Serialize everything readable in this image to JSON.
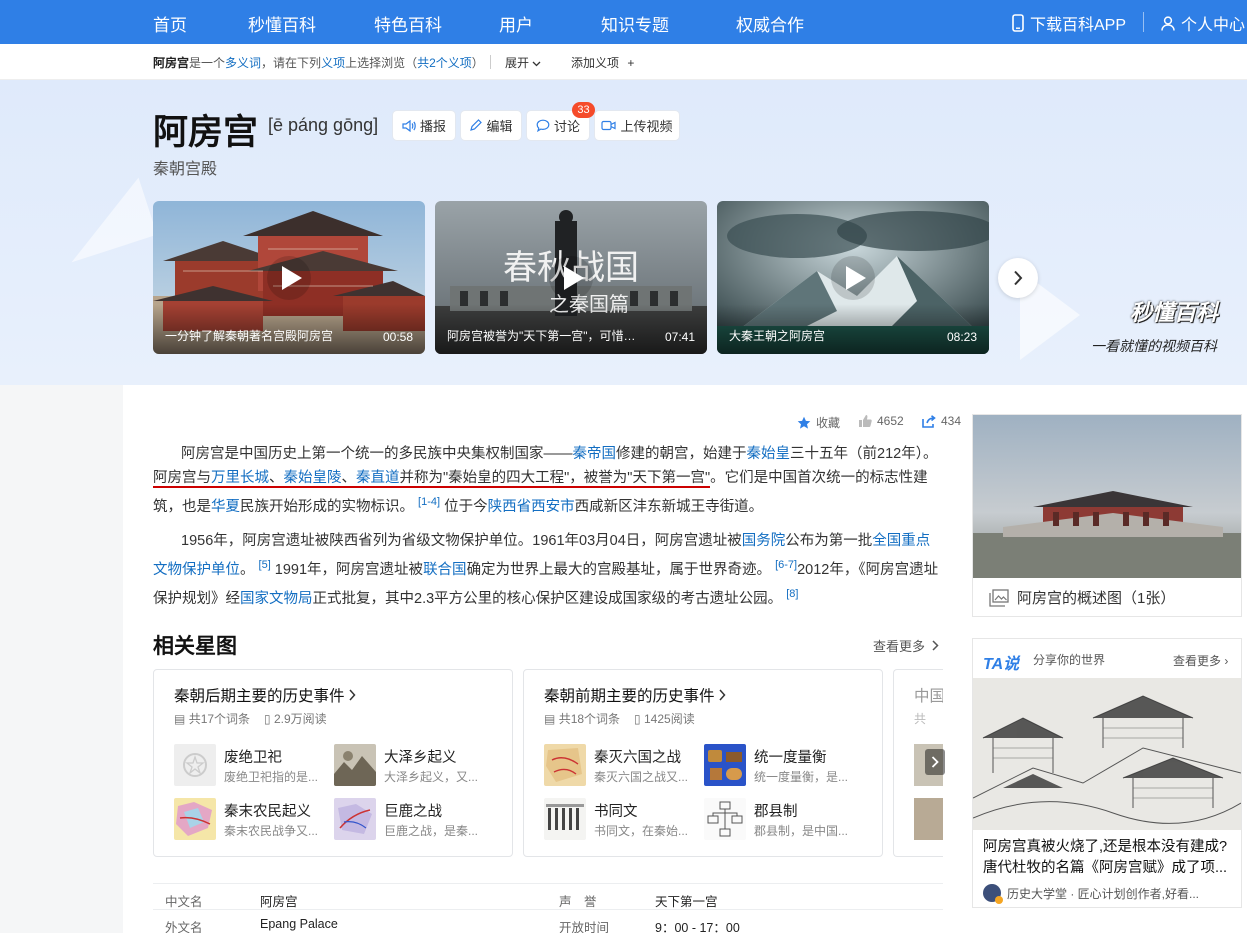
{
  "nav": {
    "items": [
      "首页",
      "秒懂百科",
      "特色百科",
      "用户",
      "知识专题",
      "权威合作"
    ],
    "download_app": "下载百科APP",
    "user_center": "个人中心"
  },
  "disambig": {
    "term": "阿房宫",
    "text1": "是一个",
    "polysemy": "多义词",
    "text2": "，请在下列",
    "sense": "义项",
    "text3": "上选择浏览（",
    "count": "共2个义项",
    "text4": "）",
    "expand": "展开",
    "add_term": "添加义项"
  },
  "header": {
    "title": "阿房宫",
    "pinyin": "[ē páng gōng]",
    "subtitle": "秦朝宫殿",
    "buttons": {
      "broadcast": "播报",
      "edit": "编辑",
      "discuss": "讨论",
      "upload": "上传视频"
    },
    "discuss_badge": "33"
  },
  "videos": [
    {
      "caption": "一分钟了解秦朝著名宫殿阿房宫",
      "duration": "00:58"
    },
    {
      "caption": "阿房宫被誉为\"天下第一宫\"，可惜最...",
      "duration": "07:41",
      "overlay_title": "春秋战国",
      "overlay_sub": "之秦国篇"
    },
    {
      "caption": "大秦王朝之阿房宫",
      "duration": "08:23"
    }
  ],
  "brand": {
    "name": "秒懂百科",
    "slogan": "一看就懂的视频百科"
  },
  "stats": {
    "favorite": "收藏",
    "likes": "4652",
    "shares": "434"
  },
  "intro": {
    "p1": {
      "a": "阿房宫是中国历史上第一个统一的多民族中央集权制国家——",
      "l1": "秦帝国",
      "b": "修建的朝宫，始建于",
      "l2": "秦始皇",
      "c": "三十五年（前212年）。",
      "u1": "阿房宫与",
      "l3": "万里长城",
      "s1": "、",
      "l4": "秦始皇陵",
      "s2": "、",
      "l5": "秦直道",
      "u2": "并称为\"秦始皇的四大工程\"，被誉为\"天下第一宫\"",
      "u3": "。",
      "d": "它们是中国首次统一的标志性建筑，也是",
      "l6": "华夏",
      "e": "民族开始形成的实物标识。",
      "ref1": "[1-4]",
      "f": "位于今",
      "l7": "陕西省西安市",
      "g": "西咸新区沣东新城王寺街道。"
    },
    "p2": {
      "a": "1956年，阿房宫遗址被陕西省列为省级文物保护单位。1961年03月04日，阿房宫遗址被",
      "l1": "国务院",
      "b": "公布为第一批",
      "l2": "全国重点文物保护单位",
      "c": "。",
      "ref1": "[5]",
      "d": "1991年，阿房宫遗址被",
      "l3": "联合国",
      "e": "确定为世界上最大的宫殿基址，属于世界奇迹。",
      "ref2": "[6-7]",
      "f": "2012年，《阿房宫遗址保护规划》经",
      "l4": "国家文物局",
      "g": "正式批复，其中2.3平方公里的核心保护区建设成国家级的考古遗址公园。",
      "ref3": "[8]"
    }
  },
  "related": {
    "title": "相关星图",
    "more": "查看更多",
    "cards": [
      {
        "title": "秦朝后期主要的历史事件",
        "terms": "共17个词条",
        "reads": "2.9万阅读",
        "items": [
          {
            "name": "废绝卫祀",
            "desc": "废绝卫祀指的是..."
          },
          {
            "name": "大泽乡起义",
            "desc": "大泽乡起义，又..."
          },
          {
            "name": "秦末农民起义",
            "desc": "秦末农民战争又..."
          },
          {
            "name": "巨鹿之战",
            "desc": "巨鹿之战，是秦..."
          }
        ]
      },
      {
        "title": "秦朝前期主要的历史事件",
        "terms": "共18个词条",
        "reads": "1425阅读",
        "items": [
          {
            "name": "秦灭六国之战",
            "desc": "秦灭六国之战又..."
          },
          {
            "name": "统一度量衡",
            "desc": "统一度量衡，是..."
          },
          {
            "name": "书同文",
            "desc": "书同文，在秦始..."
          },
          {
            "name": "郡县制",
            "desc": "郡县制，是中国..."
          }
        ]
      }
    ],
    "peek_title": "中国",
    "peek_meta": "共"
  },
  "infobox": [
    {
      "k1": "中文名",
      "v1": "阿房宫",
      "k2": "声　誉",
      "v2": "天下第一宫"
    },
    {
      "k1": "外文名",
      "v1": "Epang Palace",
      "k2": "开放时间",
      "v2": "9：00 - 17：00"
    }
  ],
  "summary": {
    "caption": "阿房宫的概述图（1张）"
  },
  "ta": {
    "logo": "TA说",
    "slogan": "分享你的世界",
    "more": "查看更多",
    "headline": "阿房宫真被火烧了,还是根本没有建成?唐代杜牧的名篇《阿房宫赋》成了项...",
    "author": "历史大学堂 · 匠心计划创作者,好看..."
  },
  "colors": {
    "nav": "#2f7fe6",
    "link": "#136ec2",
    "badge": "#f54b2a",
    "underline": "#cc0000"
  }
}
